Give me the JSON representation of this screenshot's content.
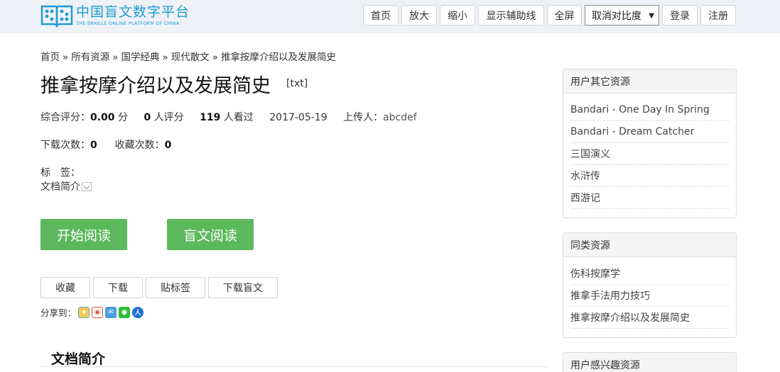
{
  "header": {
    "logo_title": "中国盲文数字平台",
    "logo_subtitle": "THE BRAILLE ONLINE PLATFORM OF CHINA",
    "buttons": {
      "home": "首页",
      "zoom_in": "放大",
      "zoom_out": "缩小",
      "guide_lines": "显示辅助线",
      "fullscreen": "全屏",
      "contrast_select": "取消对比度",
      "login": "登录",
      "register": "注册"
    }
  },
  "breadcrumb": [
    "首页",
    "所有资源",
    "国学经典",
    "现代散文",
    "推拿按摩介绍以及发展简史"
  ],
  "breadcrumb_sep": "»",
  "doc": {
    "title": "推拿按摩介绍以及发展简史",
    "format": "[txt]",
    "rating_label": "综合评分：",
    "rating_value": "0.00",
    "rating_unit": "分",
    "raters_value": "0",
    "raters_label": "人评分",
    "views_value": "119",
    "views_label": "人看过",
    "date": "2017-05-19",
    "uploader_label": "上传人：",
    "uploader": "abcdef",
    "downloads_label": "下载次数：",
    "downloads_value": "0",
    "favorites_label": "收藏次数：",
    "favorites_value": "0",
    "tags_label": "标　签：",
    "intro_toggle": "文档简介"
  },
  "actions": {
    "start_reading": "开始阅读",
    "braille_reading": "盲文阅读",
    "favorite": "收藏",
    "download": "下载",
    "add_tag": "贴标签",
    "download_braille": "下载盲文",
    "share_label": "分享到："
  },
  "section_intro_title": "文档简介",
  "sidebar": {
    "other_resources": {
      "title": "用户其它资源",
      "items": [
        "Bandari - One Day In Spring",
        "Bandari - Dream Catcher",
        "三国演义",
        "水浒传",
        "西游记"
      ]
    },
    "similar_resources": {
      "title": "同类资源",
      "items": [
        "伤科按摩学",
        "推拿手法用力技巧",
        "推拿按摩介绍以及发展简史"
      ]
    },
    "interest_resources": {
      "title": "用户感兴趣资源"
    }
  },
  "colors": {
    "brand": "#1f9bd3",
    "primary_button": "#5cb85c",
    "header_bg": "#eef2f7"
  }
}
